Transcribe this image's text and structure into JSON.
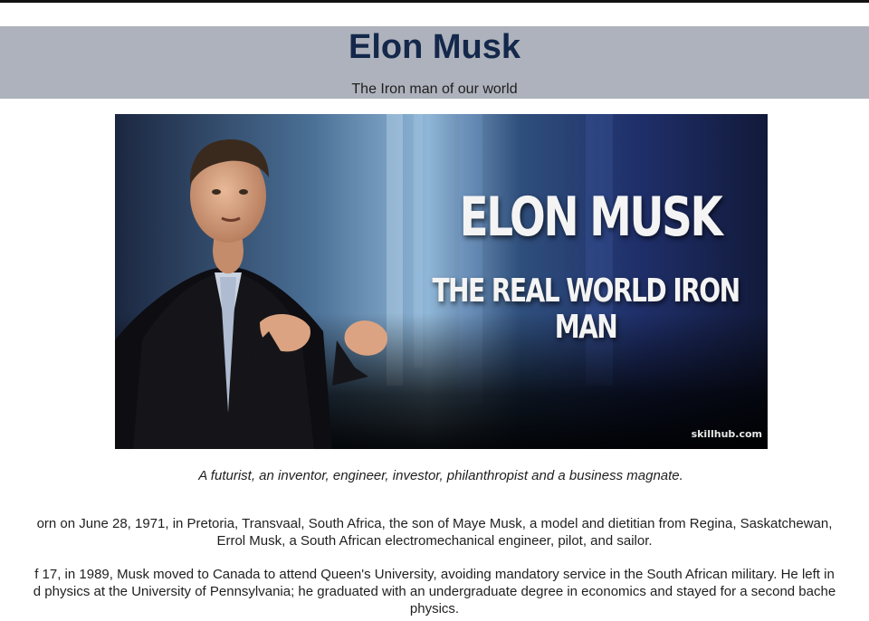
{
  "header": {
    "title": "Elon Musk",
    "subtitle": "The Iron man of our world"
  },
  "hero": {
    "banner_title": "ELON MUSK",
    "banner_subtitle": "THE REAL WORLD IRON MAN",
    "watermark": "skillhub.com"
  },
  "caption": "A futurist, an inventor, engineer, investor, philanthropist and a business magnate.",
  "paragraphs": [
    {
      "lines": [
        "orn on June 28, 1971, in Pretoria, Transvaal, South Africa, the son of Maye Musk, a model and dietitian from Regina, Saskatchewan,",
        "Errol Musk, a South African electromechanical engineer, pilot, and sailor."
      ]
    },
    {
      "lines": [
        "f 17, in 1989, Musk moved to Canada to attend Queen's University, avoiding mandatory service in the South African military. He left in",
        "d physics at the University of Pennsylvania; he graduated with an undergraduate degree in economics and stayed for a second bache",
        "physics."
      ]
    }
  ],
  "colors": {
    "header_bg": "#aeb2bc",
    "title": "#13284b",
    "text": "#1f1f1f"
  }
}
